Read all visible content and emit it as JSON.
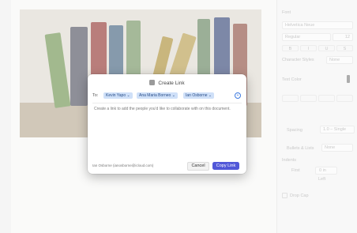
{
  "dialog": {
    "title": "Create Link",
    "to_label": "To:",
    "recipients": [
      "Kevin Yapo ⌄",
      "Ana Maria Borneo ⌄",
      "Ian Osborne ⌄"
    ],
    "message": "Create a link to add the people you'd like to collaborate with on this document.",
    "link": "Ian Osborne (ianosborne@icloud.com)",
    "cancel_label": "Cancel",
    "copy_link_label": "Copy Link",
    "accent_color": "#5158d8"
  },
  "inspector": {
    "font_header": "Font",
    "font_name": "Helvetica Neue",
    "font_style": "Regular",
    "font_size": "12",
    "style_buttons": [
      "B",
      "I",
      "U",
      "S"
    ],
    "character_styles_label": "Character Styles",
    "character_styles_value": "None",
    "text_color_label": "Text Color",
    "spacing_label": "Spacing",
    "spacing_value": "1.0 – Single",
    "bullets_label": "Bullets & Lists",
    "bullets_value": "None",
    "indents_label": "Indents",
    "indent_first_label": "First",
    "indent_first_value": "0 in",
    "indent_left_label": "Left",
    "drop_cap_label": "Drop Cap"
  }
}
